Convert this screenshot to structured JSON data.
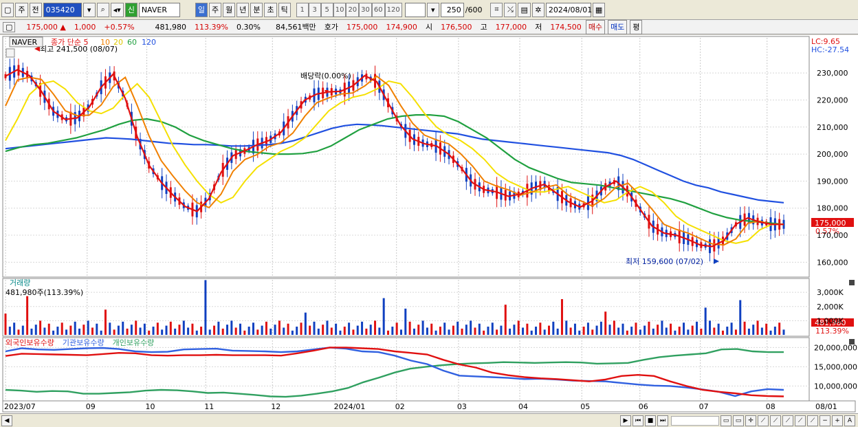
{
  "toolbar": {
    "period": "주",
    "view": "전",
    "code": "035420",
    "search_icon": "search-icon",
    "name": "NAVER",
    "credit": "신",
    "timeframes": [
      {
        "label": "일",
        "selected": true
      },
      {
        "label": "주"
      },
      {
        "label": "월"
      },
      {
        "label": "년"
      },
      {
        "label": "분"
      },
      {
        "label": "초"
      },
      {
        "label": "틱"
      }
    ],
    "intervals": [
      "1",
      "3",
      "5",
      "10",
      "20",
      "30",
      "60",
      "120"
    ],
    "count": "250",
    "total": "/600",
    "date": "2024/08/01"
  },
  "quote": {
    "price": "175,000",
    "arrow": "▲",
    "change": "1,000",
    "pct": "+0.57%",
    "volume": "481,980",
    "vol_ratio": "113.39%",
    "turnover": "0.30%",
    "amount": "84,561백만",
    "bid_label": "호가",
    "ask": "175,000",
    "bid": "174,900",
    "open_label": "시",
    "open": "176,500",
    "high_label": "고",
    "high": "177,000",
    "low_label": "저",
    "low": "174,500",
    "buy": "매수",
    "sell": "매도",
    "avg": "평"
  },
  "chart_data": {
    "type": "line",
    "title": "NAVER",
    "legend": [
      "종가 단순",
      "5",
      "10",
      "20",
      "60",
      "120"
    ],
    "colors": {
      "ma5": "#e01010",
      "ma10": "#f08000",
      "ma20": "#f5e000",
      "ma60": "#20a040",
      "ma120": "#2050e0",
      "up": "#e01010",
      "down": "#1040c0",
      "foreign": "#e01010",
      "inst": "#3060e0",
      "retail": "#30a060"
    },
    "ylim": [
      155000,
      243000
    ],
    "y_ticks": [
      160000,
      170000,
      180000,
      190000,
      200000,
      210000,
      220000,
      230000
    ],
    "y_tick_labels": [
      "160,000",
      "170,000",
      "180,000",
      "190,000",
      "200,000",
      "210,000",
      "220,000",
      "230,000"
    ],
    "x_labels": [
      "2023/07",
      "09",
      "10",
      "11",
      "12",
      "2024/01",
      "02",
      "03",
      "04",
      "05",
      "06",
      "07",
      "08"
    ],
    "x_label_fraction": [
      0,
      0.104,
      0.18,
      0.255,
      0.34,
      0.42,
      0.498,
      0.577,
      0.655,
      0.734,
      0.808,
      0.885,
      0.97
    ],
    "last_x_label": "08/01",
    "ma20_price": [
      205000,
      213000,
      222000,
      226000,
      227000,
      224000,
      219000,
      216000,
      215000,
      217000,
      222000,
      226000,
      221000,
      212000,
      203000,
      196000,
      190000,
      185000,
      182000,
      184000,
      190000,
      195000,
      198000,
      201000,
      203000,
      206000,
      211000,
      216000,
      219000,
      221000,
      222000,
      224000,
      227000,
      226000,
      221000,
      215000,
      210000,
      207000,
      205000,
      202000,
      198000,
      193000,
      190000,
      188000,
      186000,
      186000,
      187000,
      188000,
      186000,
      184000,
      182000,
      183000,
      186000,
      188000,
      186000,
      182000,
      177000,
      174000,
      172000,
      170000,
      168000,
      167000,
      168000,
      172000,
      174000,
      174000
    ],
    "ma120_price": [
      202000,
      202500,
      203000,
      203500,
      204000,
      204500,
      205000,
      205500,
      206000,
      205800,
      205500,
      205000,
      204500,
      204000,
      203800,
      203500,
      203500,
      203300,
      203000,
      203000,
      203200,
      203500,
      204000,
      205000,
      206500,
      208000,
      209500,
      210500,
      211000,
      210800,
      210500,
      210000,
      209500,
      209000,
      208500,
      208000,
      207500,
      206500,
      205500,
      205000,
      204500,
      204000,
      203500,
      203000,
      202500,
      202000,
      201500,
      201000,
      200500,
      199500,
      198000,
      196000,
      194000,
      192000,
      190000,
      188500,
      187500,
      186000,
      185000,
      184000,
      183000,
      182500,
      182000
    ],
    "ma60_price": [
      201000,
      202500,
      203500,
      204000,
      205000,
      206000,
      207500,
      209000,
      211000,
      212500,
      213000,
      212000,
      210000,
      207000,
      205000,
      203500,
      202000,
      201000,
      200500,
      200000,
      200000,
      200200,
      201000,
      203000,
      206000,
      209000,
      211000,
      213000,
      214000,
      214500,
      214500,
      214000,
      212000,
      209000,
      206000,
      202000,
      198000,
      195000,
      193000,
      191000,
      189500,
      189000,
      188500,
      187500,
      186500,
      185500,
      184500,
      183500,
      182000,
      180000,
      178000,
      176500,
      175500,
      175000,
      174500,
      174000
    ],
    "high_label": "최고 241,500 (08/07)",
    "low_label": "최저 159,600 (07/02)",
    "dividend_label": "배당락(0.00%)",
    "lc_label": "LC:9.65",
    "hc_label": "HC:-27.54",
    "last_price_label": "175,000",
    "last_pct_label": "0.57%",
    "volume_panel": {
      "title": "거래량",
      "value_label": "481,980주(113.39%)",
      "y_tick_labels": [
        "3,000K",
        "2,000K",
        "1,000K"
      ],
      "ylim": [
        0,
        3200
      ],
      "last_label": "481,980",
      "last_pct_label": "113.39%"
    },
    "holdings_panel": {
      "legend": [
        "외국인보유수량",
        "기관보유수량",
        "개인보유수량"
      ],
      "y_tick_labels": [
        "20,000,000",
        "15,000,000",
        "10,000,000"
      ],
      "ylim": [
        6500000,
        21500000
      ],
      "foreign": [
        17800000,
        18400000,
        18300000,
        18200000,
        18100000,
        18000000,
        18300000,
        18600000,
        18500000,
        18000000,
        17900000,
        18000000,
        18000000,
        18100000,
        18000000,
        18000000,
        18000000,
        17900000,
        18500000,
        19200000,
        20000000,
        20000000,
        19800000,
        19600000,
        19000000,
        18600000,
        18200000,
        16800000,
        15600000,
        14800000,
        13500000,
        12800000,
        12300000,
        12000000,
        11800000,
        11500000,
        11200000,
        11700000,
        12600000,
        12900000,
        12600000,
        11200000,
        10000000,
        9000000,
        8500000,
        8100000,
        7600000,
        7400000,
        7300000
      ],
      "inst": [
        19000000,
        19800000,
        19500000,
        19400000,
        19600000,
        19800000,
        19900000,
        19600000,
        19000000,
        18800000,
        18900000,
        19500000,
        19600000,
        19700000,
        19200000,
        19100000,
        19000000,
        18800000,
        19000000,
        19500000,
        20000000,
        19700000,
        19000000,
        18800000,
        17900000,
        16600000,
        15700000,
        14000000,
        12700000,
        12500000,
        12300000,
        12100000,
        11800000,
        11900000,
        11700000,
        11400000,
        11300000,
        11200000,
        10800000,
        10400000,
        10100000,
        10000000,
        9600000,
        9100000,
        8500000,
        7400000,
        8600000,
        9200000,
        9000000
      ],
      "retail": [
        9000000,
        8800000,
        8500000,
        8700000,
        8600000,
        8000000,
        8000000,
        8200000,
        8400000,
        8800000,
        9000000,
        8900000,
        8600000,
        8200000,
        8300000,
        8000000,
        7700000,
        7300000,
        7200000,
        7500000,
        8000000,
        8600000,
        9500000,
        11000000,
        12200000,
        13500000,
        14500000,
        15000000,
        15400000,
        15700000,
        15900000,
        16000000,
        16200000,
        16100000,
        16000000,
        16100000,
        16200000,
        16100000,
        15800000,
        15900000,
        16000000,
        16800000,
        17500000,
        17900000,
        18200000,
        18500000,
        19500000,
        19600000,
        19000000,
        18800000,
        18800000
      ]
    }
  }
}
